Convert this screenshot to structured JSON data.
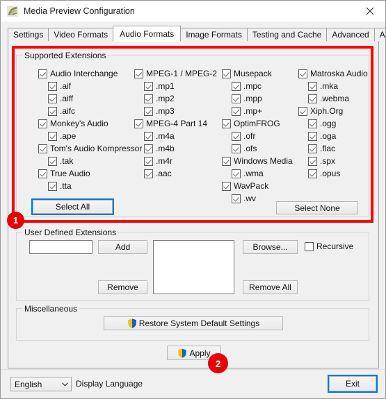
{
  "window": {
    "title": "Media Preview Configuration",
    "app_icon": "media-preview-icon",
    "close_icon": "close-icon"
  },
  "tabs": [
    {
      "label": "Settings",
      "active": false
    },
    {
      "label": "Video Formats",
      "active": false
    },
    {
      "label": "Audio Formats",
      "active": true
    },
    {
      "label": "Image Formats",
      "active": false
    },
    {
      "label": "Testing and Cache",
      "active": false
    },
    {
      "label": "Advanced",
      "active": false
    },
    {
      "label": "About...",
      "active": false
    }
  ],
  "supported_extensions": {
    "title": "Supported Extensions",
    "columns": [
      {
        "items": [
          {
            "label": "Audio Interchange",
            "checked": true,
            "indent": false
          },
          {
            "label": ".aif",
            "checked": true,
            "indent": true
          },
          {
            "label": ".aiff",
            "checked": true,
            "indent": true
          },
          {
            "label": ".aifc",
            "checked": true,
            "indent": true
          },
          {
            "label": "Monkey's Audio",
            "checked": true,
            "indent": false
          },
          {
            "label": ".ape",
            "checked": true,
            "indent": true
          },
          {
            "label": "Tom's Audio Kompressor",
            "checked": true,
            "indent": false
          },
          {
            "label": ".tak",
            "checked": true,
            "indent": true
          },
          {
            "label": "True Audio",
            "checked": true,
            "indent": false
          },
          {
            "label": ".tta",
            "checked": true,
            "indent": true
          }
        ]
      },
      {
        "items": [
          {
            "label": "MPEG-1 / MPEG-2",
            "checked": true,
            "indent": false
          },
          {
            "label": ".mp1",
            "checked": true,
            "indent": true
          },
          {
            "label": ".mp2",
            "checked": true,
            "indent": true
          },
          {
            "label": ".mp3",
            "checked": true,
            "indent": true
          },
          {
            "label": "MPEG-4 Part 14",
            "checked": true,
            "indent": false
          },
          {
            "label": ".m4a",
            "checked": true,
            "indent": true
          },
          {
            "label": ".m4b",
            "checked": true,
            "indent": true
          },
          {
            "label": ".m4r",
            "checked": true,
            "indent": true
          },
          {
            "label": ".aac",
            "checked": true,
            "indent": true
          }
        ]
      },
      {
        "items": [
          {
            "label": "Musepack",
            "checked": true,
            "indent": false
          },
          {
            "label": ".mpc",
            "checked": true,
            "indent": true
          },
          {
            "label": ".mpp",
            "checked": true,
            "indent": true
          },
          {
            "label": ".mp+",
            "checked": true,
            "indent": true
          },
          {
            "label": "OptimFROG",
            "checked": true,
            "indent": false
          },
          {
            "label": ".ofr",
            "checked": true,
            "indent": true
          },
          {
            "label": ".ofs",
            "checked": true,
            "indent": true
          },
          {
            "label": "Windows Media",
            "checked": true,
            "indent": false
          },
          {
            "label": ".wma",
            "checked": true,
            "indent": true
          },
          {
            "label": "WavPack",
            "checked": true,
            "indent": false
          },
          {
            "label": ".wv",
            "checked": true,
            "indent": true
          }
        ]
      },
      {
        "items": [
          {
            "label": "Matroska Audio",
            "checked": true,
            "indent": false
          },
          {
            "label": ".mka",
            "checked": true,
            "indent": true
          },
          {
            "label": ".webma",
            "checked": true,
            "indent": true
          },
          {
            "label": "Xiph.Org",
            "checked": true,
            "indent": false
          },
          {
            "label": ".ogg",
            "checked": true,
            "indent": true
          },
          {
            "label": ".oga",
            "checked": true,
            "indent": true
          },
          {
            "label": ".flac",
            "checked": true,
            "indent": true
          },
          {
            "label": ".spx",
            "checked": true,
            "indent": true
          },
          {
            "label": ".opus",
            "checked": true,
            "indent": true
          }
        ]
      }
    ],
    "select_all_label": "Select All",
    "select_none_label": "Select None"
  },
  "user_defined": {
    "title": "User Defined Extensions",
    "input_value": "",
    "add_label": "Add",
    "remove_label": "Remove",
    "browse_label": "Browse...",
    "remove_all_label": "Remove All",
    "recursive_label": "Recursive",
    "recursive_checked": false,
    "list_items": []
  },
  "miscellaneous": {
    "title": "Miscellaneous",
    "restore_label": "Restore System Default Settings",
    "restore_icon": "uac-shield-icon"
  },
  "apply": {
    "label": "Apply",
    "icon": "uac-shield-icon"
  },
  "footer": {
    "language_value": "English",
    "language_caret": "chevron-down-icon",
    "display_language_label": "Display Language",
    "exit_label": "Exit"
  },
  "annotations": [
    {
      "id": "1",
      "label": "1"
    },
    {
      "id": "2",
      "label": "2"
    }
  ],
  "colors": {
    "highlight_red": "#ff0000",
    "badge_red": "#e60000",
    "focus_blue": "#0078d7",
    "window_bg": "#f0f0f0"
  }
}
